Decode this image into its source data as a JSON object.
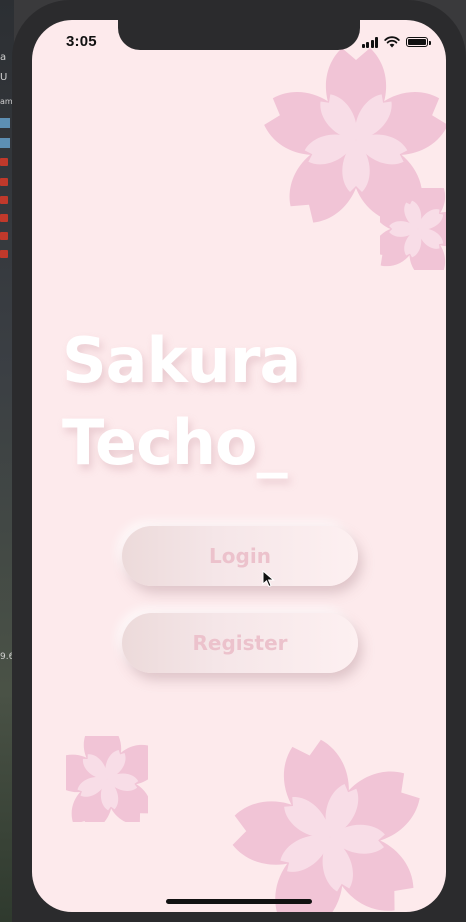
{
  "status_bar": {
    "time": "3:05",
    "icons": [
      "signal-icon",
      "wifi-icon",
      "battery-icon"
    ]
  },
  "app": {
    "title_line1": "Sakura",
    "title_line2": "Techo_"
  },
  "buttons": {
    "login_label": "Login",
    "register_label": "Register"
  },
  "desktop_fragments": {
    "text_a": "a",
    "text_u": "U",
    "text_am": "am",
    "text_num": "9.6"
  },
  "colors": {
    "background": "#fdeaec",
    "petal_dark": "#f1c4d6",
    "petal_light": "#f8dde7",
    "button_text": "#ecc2cc",
    "title": "#ffffff"
  }
}
